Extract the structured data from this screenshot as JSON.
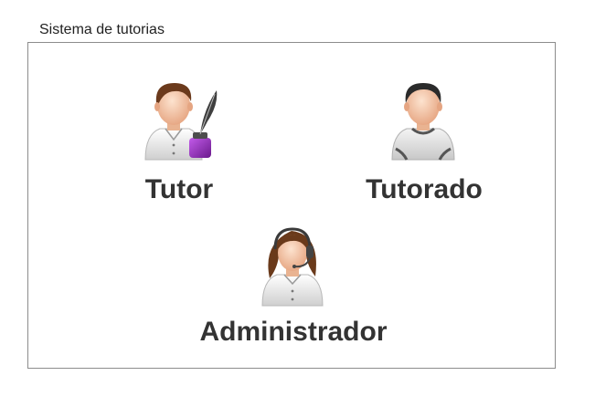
{
  "window": {
    "title": "Sistema de tutorias"
  },
  "roles": [
    {
      "label": "Tutor",
      "icon": "tutor-icon"
    },
    {
      "label": "Tutorado",
      "icon": "student-icon"
    },
    {
      "label": "Administrador",
      "icon": "admin-headset-icon"
    }
  ],
  "colors": {
    "label_text": "#333333",
    "panel_border": "#8c8c8c",
    "ink_bottle": "#8e2bb3"
  }
}
